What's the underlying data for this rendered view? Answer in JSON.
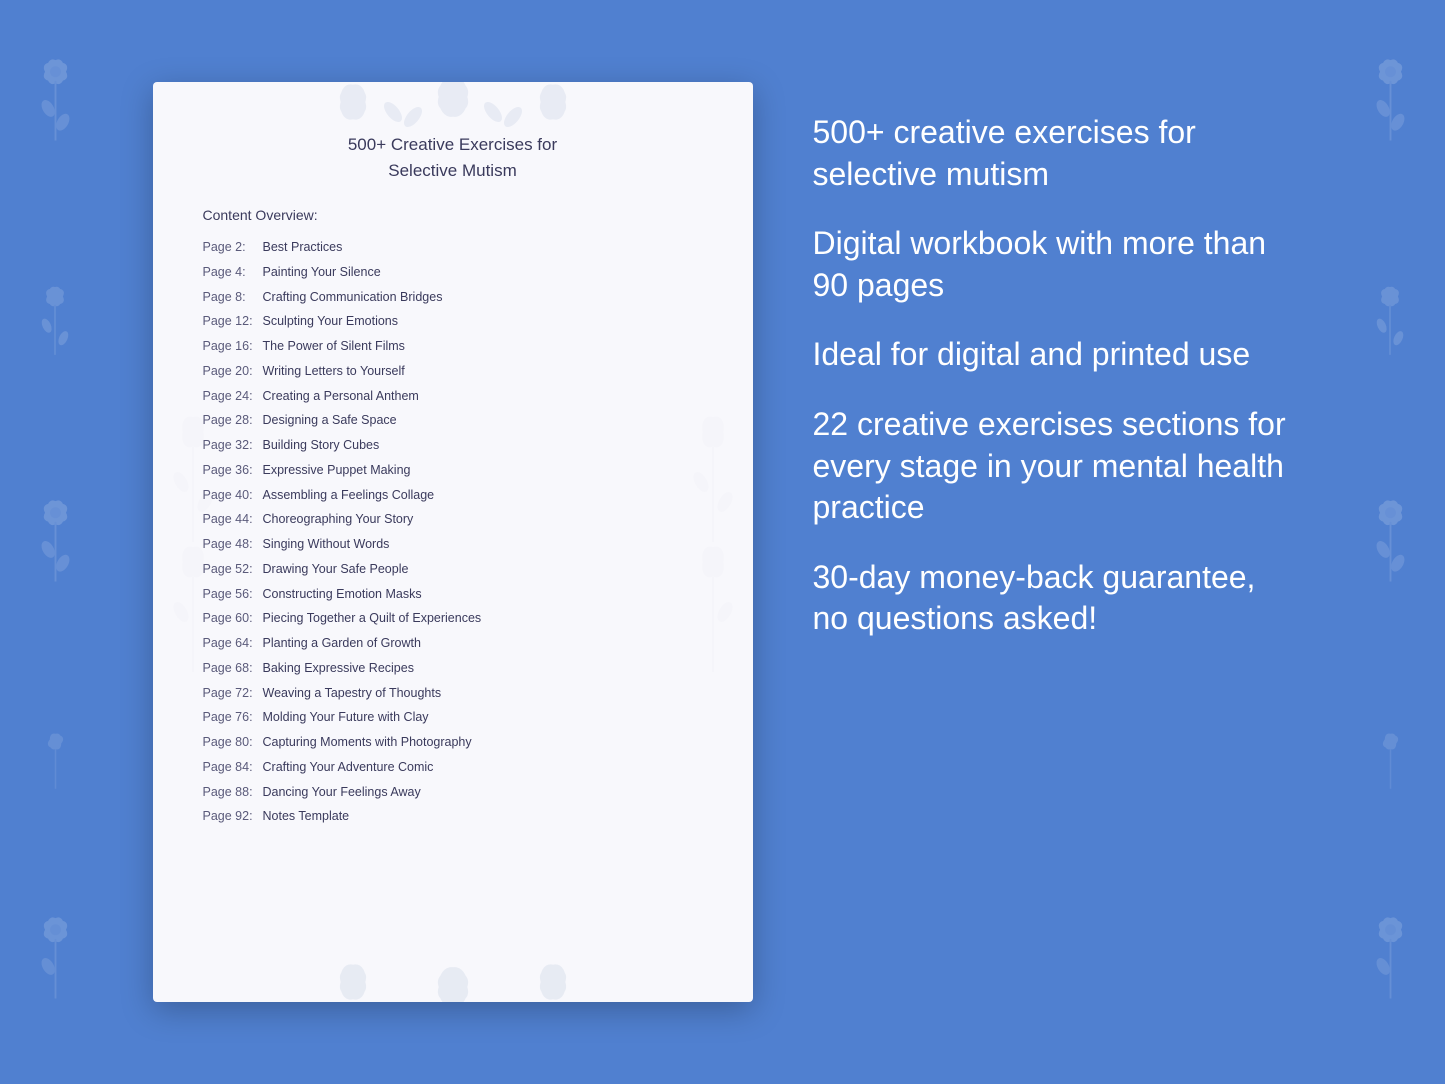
{
  "background": {
    "color": "#5080d0"
  },
  "book": {
    "title_line1": "500+ Creative Exercises for",
    "title_line2": "Selective Mutism",
    "content_overview_label": "Content Overview:",
    "toc": [
      {
        "page": "Page  2:",
        "title": "Best Practices"
      },
      {
        "page": "Page  4:",
        "title": "Painting Your Silence"
      },
      {
        "page": "Page  8:",
        "title": "Crafting Communication Bridges"
      },
      {
        "page": "Page 12:",
        "title": "Sculpting Your Emotions"
      },
      {
        "page": "Page 16:",
        "title": "The Power of Silent Films"
      },
      {
        "page": "Page 20:",
        "title": "Writing Letters to Yourself"
      },
      {
        "page": "Page 24:",
        "title": "Creating a Personal Anthem"
      },
      {
        "page": "Page 28:",
        "title": "Designing a Safe Space"
      },
      {
        "page": "Page 32:",
        "title": "Building Story Cubes"
      },
      {
        "page": "Page 36:",
        "title": "Expressive Puppet Making"
      },
      {
        "page": "Page 40:",
        "title": "Assembling a Feelings Collage"
      },
      {
        "page": "Page 44:",
        "title": "Choreographing Your Story"
      },
      {
        "page": "Page 48:",
        "title": "Singing Without Words"
      },
      {
        "page": "Page 52:",
        "title": "Drawing Your Safe People"
      },
      {
        "page": "Page 56:",
        "title": "Constructing Emotion Masks"
      },
      {
        "page": "Page 60:",
        "title": "Piecing Together a Quilt of Experiences"
      },
      {
        "page": "Page 64:",
        "title": "Planting a Garden of Growth"
      },
      {
        "page": "Page 68:",
        "title": "Baking Expressive Recipes"
      },
      {
        "page": "Page 72:",
        "title": "Weaving a Tapestry of Thoughts"
      },
      {
        "page": "Page 76:",
        "title": "Molding Your Future with Clay"
      },
      {
        "page": "Page 80:",
        "title": "Capturing Moments with Photography"
      },
      {
        "page": "Page 84:",
        "title": "Crafting Your Adventure Comic"
      },
      {
        "page": "Page 88:",
        "title": "Dancing Your Feelings Away"
      },
      {
        "page": "Page 92:",
        "title": "Notes Template"
      }
    ]
  },
  "features": [
    {
      "text": "500+ creative exercises for selective mutism"
    },
    {
      "text": "Digital workbook with more than 90 pages"
    },
    {
      "text": "Ideal for digital and printed use"
    },
    {
      "text": "22 creative exercises sections for every stage in your mental health practice"
    },
    {
      "text": "30-day money-back guarantee, no questions asked!"
    }
  ]
}
